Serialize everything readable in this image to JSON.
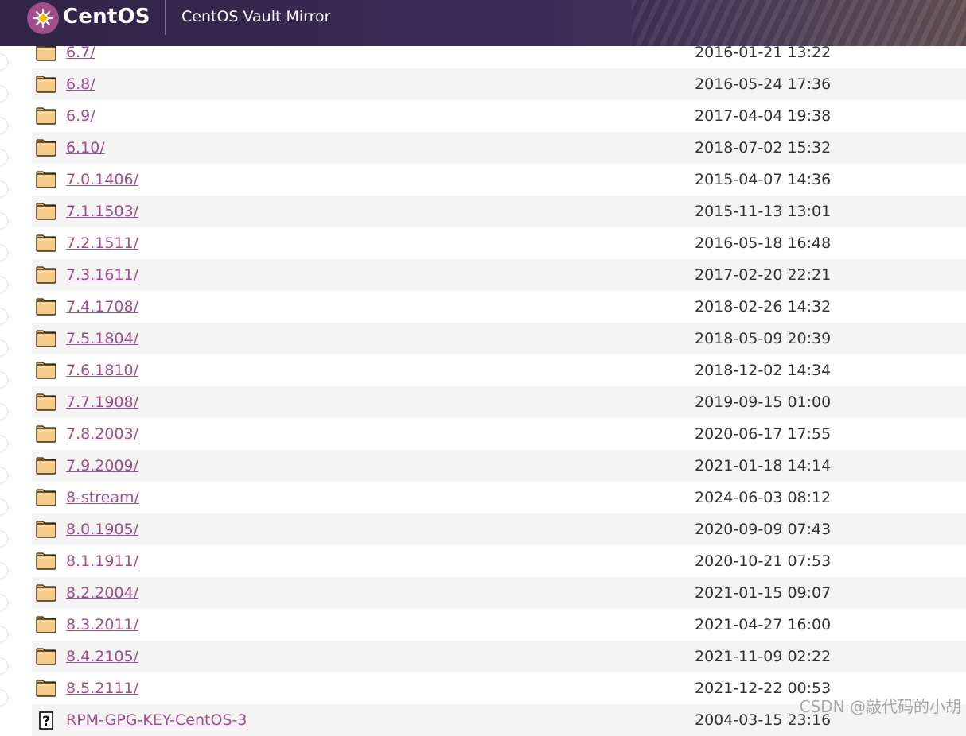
{
  "header": {
    "logo_text": "CentOS",
    "title": "CentOS Vault Mirror",
    "logo_icon": "centos-logo-icon"
  },
  "colors": {
    "header_bg": "#2f2447",
    "link": "#a14f8c",
    "row_alt": "#f4f4f4",
    "folder_fill": "#f6c98a"
  },
  "listing": {
    "rows": [
      {
        "name": "6.7/",
        "date": "2016-01-21 13:22",
        "icon": "folder-icon"
      },
      {
        "name": "6.8/",
        "date": "2016-05-24 17:36",
        "icon": "folder-icon"
      },
      {
        "name": "6.9/",
        "date": "2017-04-04 19:38",
        "icon": "folder-icon"
      },
      {
        "name": "6.10/",
        "date": "2018-07-02 15:32",
        "icon": "folder-icon"
      },
      {
        "name": "7.0.1406/",
        "date": "2015-04-07 14:36",
        "icon": "folder-icon"
      },
      {
        "name": "7.1.1503/",
        "date": "2015-11-13 13:01",
        "icon": "folder-icon"
      },
      {
        "name": "7.2.1511/",
        "date": "2016-05-18 16:48",
        "icon": "folder-icon"
      },
      {
        "name": "7.3.1611/",
        "date": "2017-02-20 22:21",
        "icon": "folder-icon"
      },
      {
        "name": "7.4.1708/",
        "date": "2018-02-26 14:32",
        "icon": "folder-icon"
      },
      {
        "name": "7.5.1804/",
        "date": "2018-05-09 20:39",
        "icon": "folder-icon"
      },
      {
        "name": "7.6.1810/",
        "date": "2018-12-02 14:34",
        "icon": "folder-icon"
      },
      {
        "name": "7.7.1908/",
        "date": "2019-09-15 01:00",
        "icon": "folder-icon"
      },
      {
        "name": "7.8.2003/",
        "date": "2020-06-17 17:55",
        "icon": "folder-icon"
      },
      {
        "name": "7.9.2009/",
        "date": "2021-01-18 14:14",
        "icon": "folder-icon"
      },
      {
        "name": "8-stream/",
        "date": "2024-06-03 08:12",
        "icon": "folder-icon"
      },
      {
        "name": "8.0.1905/",
        "date": "2020-09-09 07:43",
        "icon": "folder-icon"
      },
      {
        "name": "8.1.1911/",
        "date": "2020-10-21 07:53",
        "icon": "folder-icon"
      },
      {
        "name": "8.2.2004/",
        "date": "2021-01-15 09:07",
        "icon": "folder-icon"
      },
      {
        "name": "8.3.2011/",
        "date": "2021-04-27 16:00",
        "icon": "folder-icon"
      },
      {
        "name": "8.4.2105/",
        "date": "2021-11-09 02:22",
        "icon": "folder-icon"
      },
      {
        "name": "8.5.2111/",
        "date": "2021-12-22 00:53",
        "icon": "folder-icon"
      },
      {
        "name": "RPM-GPG-KEY-CentOS-3",
        "date": "2004-03-15 23:16",
        "icon": "unknown-file-icon"
      }
    ]
  },
  "watermark": "CSDN @敲代码的小胡"
}
